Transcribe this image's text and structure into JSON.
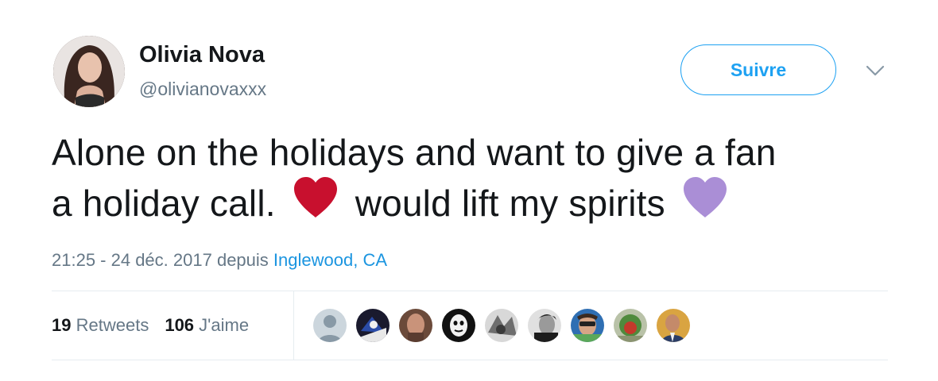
{
  "author": {
    "name": "Olivia Nova",
    "handle": "@olivianovaxxx"
  },
  "follow_label": "Suivre",
  "tweet": {
    "line1": "Alone on the holidays and want to give a fan",
    "line2a": "a holiday call.",
    "line2b": "would lift my spirits",
    "emoji1": "red-heart",
    "emoji2": "purple-heart"
  },
  "meta": {
    "time": "21:25 - 24 déc. 2017",
    "depuis": "depuis",
    "location": "Inglewood, CA"
  },
  "stats": {
    "retweets_count": "19",
    "retweets_label": "Retweets",
    "likes_count": "106",
    "likes_label": "J'aime"
  },
  "colors": {
    "accent": "#1da1f2",
    "link": "#1b95e0",
    "muted": "#657786",
    "red_heart": "#c8102e",
    "purple_heart": "#aa8ed6"
  },
  "likers": [
    {
      "icon": "default-profile-icon"
    },
    {
      "icon": "avatar-icon"
    },
    {
      "icon": "avatar-icon"
    },
    {
      "icon": "avatar-icon"
    },
    {
      "icon": "avatar-icon"
    },
    {
      "icon": "avatar-icon"
    },
    {
      "icon": "avatar-icon"
    },
    {
      "icon": "avatar-icon"
    },
    {
      "icon": "avatar-icon"
    }
  ]
}
